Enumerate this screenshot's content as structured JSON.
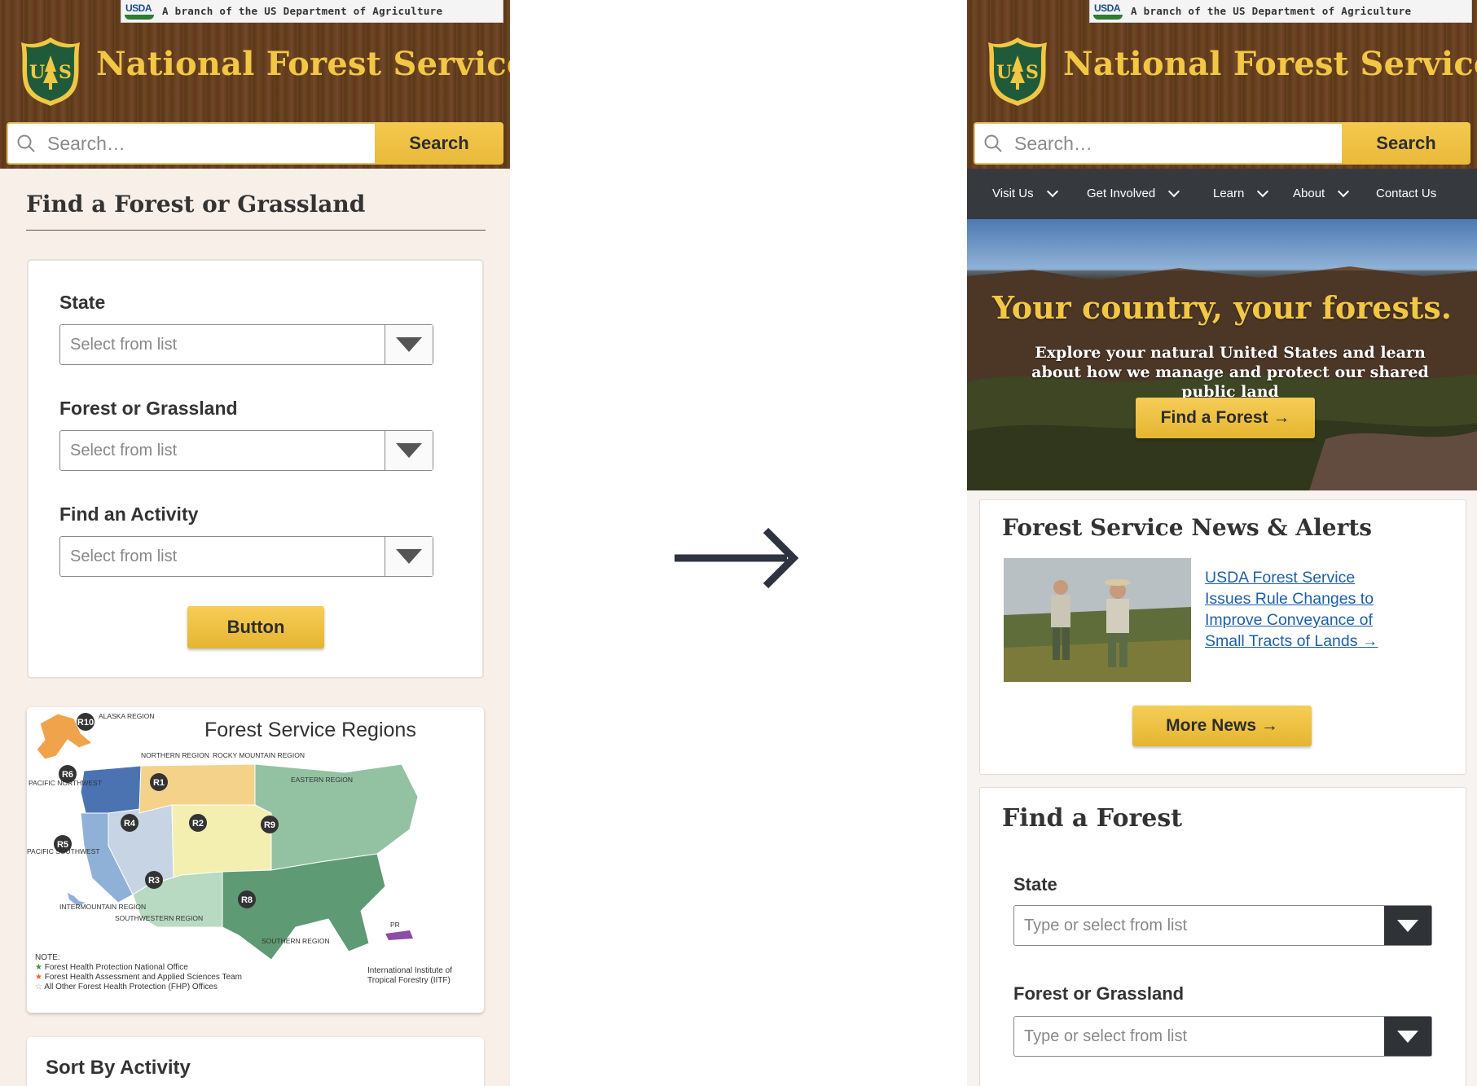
{
  "usda_banner": "A branch of the US Department of Agriculture",
  "usda_logo_text": "USDA",
  "site_title": "National Forest Service",
  "search": {
    "placeholder": "Search…",
    "button": "Search"
  },
  "left": {
    "heading": "Find a Forest or Grassland",
    "fields": [
      {
        "label": "State",
        "placeholder": "Select from list"
      },
      {
        "label": "Forest or Grassland",
        "placeholder": "Select from list"
      },
      {
        "label": "Find an Activity",
        "placeholder": "Select from list"
      }
    ],
    "button": "Button",
    "map": {
      "title": "Forest Service Regions",
      "regions": [
        {
          "code": "R10",
          "name": "ALASKA REGION"
        },
        {
          "code": "R1",
          "name": "NORTHERN REGION"
        },
        {
          "code": "R2",
          "name": "ROCKY MOUNTAIN REGION"
        },
        {
          "code": "R9",
          "name": "EASTERN REGION"
        },
        {
          "code": "R6",
          "name": "PACIFIC NORTHWEST"
        },
        {
          "code": "R5",
          "name": "PACIFIC SOUTHWEST"
        },
        {
          "code": "R4",
          "name": "INTERMOUNTAIN REGION"
        },
        {
          "code": "R3",
          "name": "SOUTHWESTERN REGION"
        },
        {
          "code": "R8",
          "name": "SOUTHERN REGION"
        }
      ],
      "notes": [
        "NOTE:",
        "Forest Health Protection National Office",
        "Forest Health Assessment and Applied Sciences Team",
        "All Other Forest Health Protection (FHP) Offices"
      ],
      "iitf": "International Institute of Tropical Forestry (IITF)",
      "pr": "PR"
    },
    "sort_heading": "Sort By Activity"
  },
  "right": {
    "nav": [
      "Visit Us",
      "Get Involved",
      "Learn",
      "About",
      "Contact Us"
    ],
    "hero_title": "Your country, your forests.",
    "hero_sub": "Explore your natural United States and learn about how we manage and protect our shared public land",
    "hero_button": "Find a Forest →",
    "news_title": "Forest Service News & Alerts",
    "news_link": "USDA Forest Service Issues Rule Changes to Improve Conveyance of Small Tracts of Lands →",
    "more_news": "More News →",
    "find_title": "Find a Forest",
    "fields": [
      {
        "label": "State",
        "placeholder": "Type or select from list"
      },
      {
        "label": "Forest or Grassland",
        "placeholder": "Type or select from list"
      }
    ]
  },
  "colors": {
    "brand_gold": "#f2c744",
    "wood": "#62401f",
    "nav_dark": "#363a3f",
    "link": "#1e5fa8",
    "arrow": "#2e3340"
  },
  "icons": [
    "search-icon",
    "forest-service-shield-icon",
    "chevron-down-icon",
    "dropdown-triangle-icon",
    "arrow-right-icon"
  ]
}
